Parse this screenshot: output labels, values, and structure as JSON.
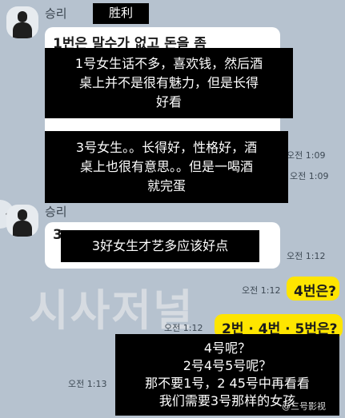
{
  "chat": {
    "sender_name_1": "승리",
    "sender_name_2": "승리",
    "msg_1_text": "1번은 말수가 없고 돈을 좀",
    "msg_3_text": "3",
    "time_1": "오전 1:09",
    "time_2": "오전 1:09",
    "time_3": "오전 1:12",
    "time_4": "오전 1:12",
    "time_5": "오전 1:13",
    "reply_1": "4번은?",
    "reply_2": "2번 · 4번 · 5번은?"
  },
  "overlay": {
    "name_tag": "胜利",
    "caption_1": [
      "1号女生话不多，喜欢钱，然后酒",
      "桌上并不是很有魅力，但是长得",
      "好看"
    ],
    "caption_2": [
      "3号女生。。长得好，性格好，酒",
      "桌上也很有意思。。但是一喝酒",
      "就完蛋"
    ],
    "caption_3": [
      "3好女生才艺多应该好点"
    ],
    "caption_4": [
      "4号呢？",
      "2号4号5号呢？",
      "那不要1号，2 45号中再看看",
      "我们需要3号那样的女孩"
    ]
  },
  "watermark": {
    "text": "시사저널",
    "corner": "@三号影视"
  },
  "colors": {
    "background": "#b6c2cf",
    "bubble_white": "#ffffff",
    "bubble_yellow": "#fee500",
    "overlay": "#000000"
  },
  "icons": {
    "scroll_left": "chevron-left-icon"
  }
}
